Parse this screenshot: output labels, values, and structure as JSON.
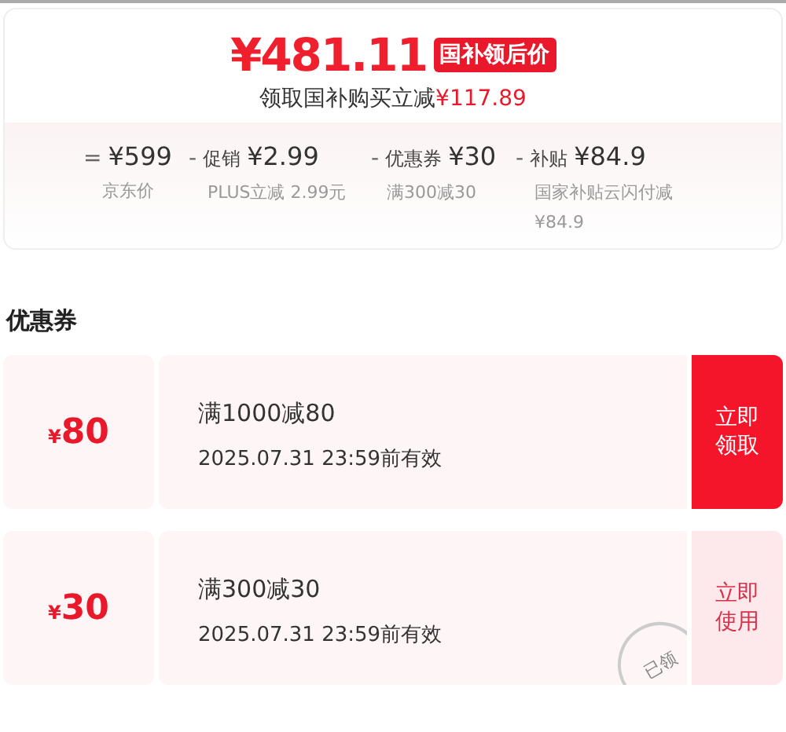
{
  "price": {
    "amount": "¥481.11",
    "badge": "国补领后价",
    "saving_label": "领取国补购买立减",
    "saving_value": "¥117.89"
  },
  "breakdown": [
    {
      "operator": "=",
      "value": "¥599",
      "note": "京东价"
    },
    {
      "operator": "-",
      "label": "促销",
      "value": "¥2.99",
      "note": "PLUS立减 2.99元"
    },
    {
      "operator": "-",
      "label": "优惠券",
      "value": "¥30",
      "note": "满300减30"
    },
    {
      "operator": "-",
      "label": "补贴",
      "value": "¥84.9",
      "note": "国家补贴云闪付减¥84.9"
    }
  ],
  "coupons_title": "优惠券",
  "coupons": [
    {
      "currency": "¥",
      "amount": "80",
      "condition": "满1000减80",
      "validity": "2025.07.31 23:59前有效",
      "action": "立即领取",
      "claimed": false
    },
    {
      "currency": "¥",
      "amount": "30",
      "condition": "满300减30",
      "validity": "2025.07.31 23:59前有效",
      "action": "立即使用",
      "claimed": true,
      "stamp": "已领"
    }
  ]
}
